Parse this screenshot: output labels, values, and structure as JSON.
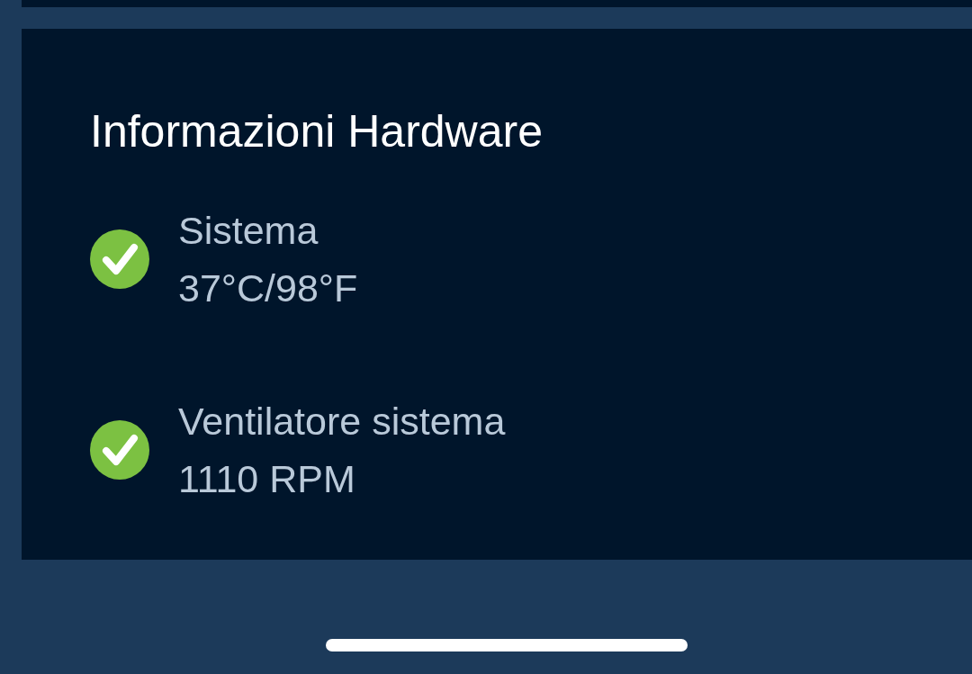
{
  "section": {
    "title": "Informazioni Hardware",
    "items": [
      {
        "label": "Sistema",
        "value": "37°C/98°F",
        "ok": true
      },
      {
        "label": "Ventilatore sistema",
        "value": "1110 RPM",
        "ok": true
      }
    ]
  }
}
